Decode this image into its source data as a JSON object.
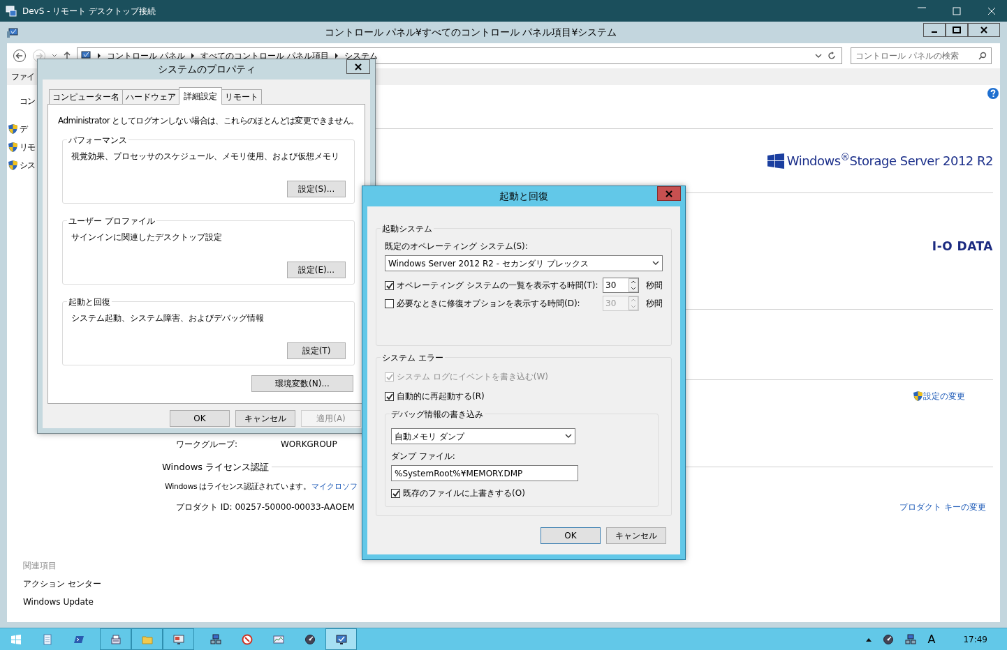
{
  "rdp_window": {
    "title": "DevS - リモート デスクトップ接続"
  },
  "explorer": {
    "title": "コントロール パネル¥すべてのコントロール パネル項目¥システム",
    "breadcrumb": [
      "コントロール パネル",
      "すべてのコントロール パネル項目",
      "システム"
    ],
    "search": {
      "placeholder": "コントロール パネルの検索"
    },
    "menu": [
      "ファイ"
    ],
    "sidebar": {
      "home": "コン",
      "items": [
        "デ",
        "リモ",
        "シス"
      ],
      "related_heading": "関連項目",
      "related": [
        "アクション センター",
        "Windows Update"
      ]
    },
    "edition_logo": "Windows$^{®}$Storage Server 2012 R2",
    "vendor_logo": "I-O DATA",
    "change_settings_link": "設定の変更",
    "workgroup": {
      "label": "ワークグループ:",
      "value": "WORKGROUP"
    },
    "license": {
      "heading": "Windows ライセンス認証",
      "status": "Windows はライセンス認証されています。",
      "link": "マイクロソフ",
      "product_id": "プロダクト ID: 00257-50000-00033-AAOEM",
      "product_key_link": "プロダクト キーの変更"
    }
  },
  "system_properties": {
    "title": "システムのプロパティ",
    "tabs": [
      {
        "label": "コンピューター名",
        "selected": false
      },
      {
        "label": "ハードウェア",
        "selected": false
      },
      {
        "label": "詳細設定",
        "selected": true
      },
      {
        "label": "リモート",
        "selected": false
      }
    ],
    "notice": "Administrator としてログオンしない場合は、これらのほとんどは変更できません。",
    "groups": [
      {
        "title": "パフォーマンス",
        "description": "視覚効果、プロセッサのスケジュール、メモリ使用、および仮想メモリ",
        "button": "設定(S)..."
      },
      {
        "title": "ユーザー プロファイル",
        "description": "サインインに関連したデスクトップ設定",
        "button": "設定(E)..."
      },
      {
        "title": "起動と回復",
        "description": "システム起動、システム障害、およびデバッグ情報",
        "button": "設定(T)"
      }
    ],
    "env_button": "環境変数(N)...",
    "buttons": [
      {
        "label": "OK",
        "disabled": false
      },
      {
        "label": "キャンセル",
        "disabled": false
      },
      {
        "label": "適用(A)",
        "disabled": true
      }
    ]
  },
  "startup_recovery": {
    "title": "起動と回復",
    "startup_group": {
      "title": "起動システム",
      "os_label": "既定のオペレーティング システム(S):",
      "os_value": "Windows Server 2012 R2 - セカンダリ プレックス",
      "timers": [
        {
          "label": "オペレーティング システムの一覧を表示する時間(T):",
          "checked": true,
          "value": "30",
          "unit": "秒間"
        },
        {
          "label": "必要なときに修復オプションを表示する時間(D):",
          "checked": false,
          "value": "30",
          "unit": "秒間"
        }
      ]
    },
    "error_group": {
      "title": "システム エラー",
      "checks": [
        {
          "label": "システム ログにイベントを書き込む(W)",
          "checked": true,
          "disabled": true
        },
        {
          "label": "自動的に再起動する(R)",
          "checked": true,
          "disabled": false
        }
      ],
      "debug": {
        "title": "デバッグ情報の書き込み",
        "type_value": "自動メモリ ダンプ",
        "dump_label": "ダンプ ファイル:",
        "dump_file": "%SystemRoot%¥MEMORY.DMP",
        "overwrite": {
          "label": "既存のファイルに上書きする(O)",
          "checked": true
        }
      }
    },
    "buttons": [
      {
        "label": "OK",
        "default": true
      },
      {
        "label": "キャンセル",
        "default": false
      }
    ]
  },
  "taskbar": {
    "items": [
      {
        "kind": "start",
        "running": false,
        "selected": false
      },
      {
        "kind": "document",
        "running": false,
        "selected": false
      },
      {
        "kind": "terminal",
        "running": false,
        "selected": false
      },
      {
        "kind": "tool",
        "running": true,
        "selected": false
      },
      {
        "kind": "folder",
        "running": true,
        "selected": false
      },
      {
        "kind": "monitor",
        "running": true,
        "selected": false
      },
      {
        "kind": "network",
        "running": false,
        "selected": false
      },
      {
        "kind": "stop",
        "running": false,
        "selected": false
      },
      {
        "kind": "chart",
        "running": false,
        "selected": false
      },
      {
        "kind": "gauge",
        "running": false,
        "selected": false
      },
      {
        "kind": "remote",
        "running": true,
        "selected": true
      }
    ],
    "ime": "A",
    "clock": "17:49"
  }
}
